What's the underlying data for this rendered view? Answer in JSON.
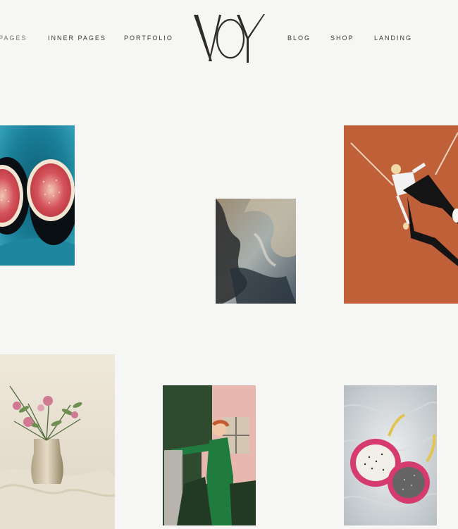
{
  "nav": {
    "left": [
      "PAGES",
      "INNER PAGES",
      "PORTFOLIO"
    ],
    "right": [
      "BLOG",
      "SHOP",
      "LANDING"
    ]
  },
  "logo": {
    "text": "VOY"
  },
  "portfolio": {
    "items": [
      {
        "name": "figs",
        "accent": "#2a8fa6"
      },
      {
        "name": "abstract-painting",
        "accent": "#8a7a66"
      },
      {
        "name": "woman-on-terracotta-wall",
        "accent": "#c9663e"
      },
      {
        "name": "flowers-in-glass-vase",
        "accent": "#e9e2d2"
      },
      {
        "name": "woman-in-green-knitwear",
        "accent": "#2f8f4f"
      },
      {
        "name": "dragon-fruit-on-fur",
        "accent": "#d53b6e"
      }
    ]
  }
}
